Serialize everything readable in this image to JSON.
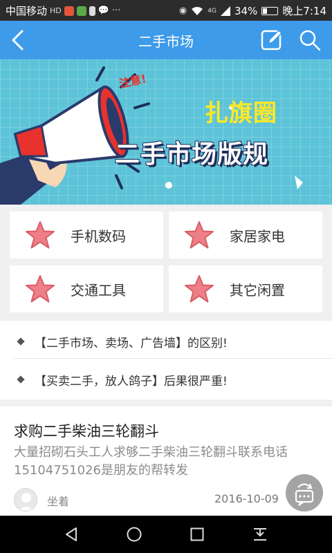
{
  "status_bar": {
    "carrier": "中国移动",
    "hd_label": "HD",
    "signal_label": "4G",
    "battery_percent": "34%",
    "battery_level": 0.34,
    "time": "晚上7:14",
    "icons": [
      "notification-icon",
      "lock-icon",
      "sim-icon",
      "wechat-icon",
      "more-icon",
      "eye-icon",
      "wifi-icon",
      "signal-icon",
      "battery-icon"
    ]
  },
  "app_bar": {
    "title": "二手市场",
    "back_icon": "chevron-left-icon",
    "edit_icon": "edit-icon",
    "search_icon": "search-icon"
  },
  "banner": {
    "notice": "注意!",
    "title_line1": "扎旗圈",
    "title_line2": "二手市场版规",
    "title1_color": "#ffe826",
    "notice_color": "#e8322d"
  },
  "categories": [
    {
      "label": "手机数码",
      "icon": "star-icon"
    },
    {
      "label": "家居家电",
      "icon": "star-icon"
    },
    {
      "label": "交通工具",
      "icon": "star-icon"
    },
    {
      "label": "其它闲置",
      "icon": "star-icon"
    }
  ],
  "notices": [
    {
      "text": "【二手市场、卖场、广告墙】的区别!"
    },
    {
      "text": "【买卖二手，放人鸽子】后果很严重!"
    }
  ],
  "post": {
    "title": "求购二手柴油三轮翻斗",
    "body": "大量招砌石头工人求够二手柴油三轮翻斗联系电话15104751026是朋友的帮转发",
    "author": "坐着",
    "date": "2016-10-09"
  },
  "colors": {
    "accent": "#3d9be9",
    "star": "#ef7f86",
    "banner_bg": "#5cc3d8"
  }
}
